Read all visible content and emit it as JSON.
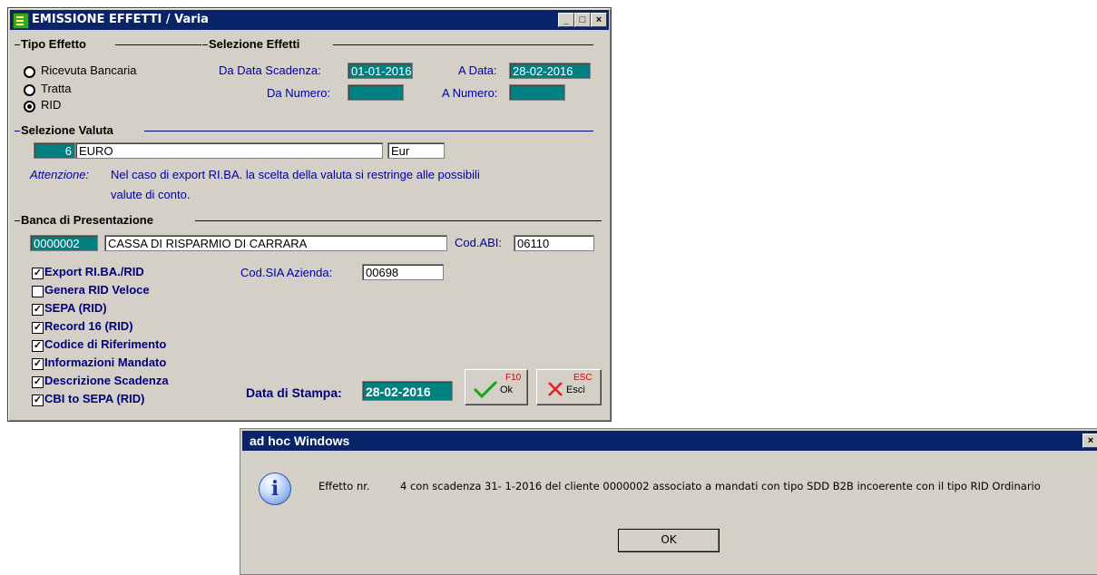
{
  "window": {
    "title": "EMISSIONE EFFETTI / Varia",
    "controls": {
      "minimize": "_",
      "maximize": "□",
      "close": "×"
    }
  },
  "tipo_effetto": {
    "heading": "Tipo Effetto",
    "options": [
      {
        "label": "Ricevuta Bancaria",
        "selected": false
      },
      {
        "label": "Tratta",
        "selected": false
      },
      {
        "label": "RID",
        "selected": true
      }
    ]
  },
  "selezione_effetti": {
    "heading": "Selezione Effetti",
    "da_data_label": "Da Data Scadenza:",
    "da_data_value": "01-01-2016",
    "a_data_label": "A Data:",
    "a_data_value": "28-02-2016",
    "da_numero_label": "Da Numero:",
    "da_numero_value": "",
    "a_numero_label": "A Numero:",
    "a_numero_value": ""
  },
  "selezione_valuta": {
    "heading": "Selezione Valuta",
    "code": "6",
    "name": "EURO",
    "symbol": "Eur",
    "note_label": "Attenzione:",
    "note_line1": "Nel caso di export RI.BA. la scelta della valuta si restringe alle possibili",
    "note_line2": "valute di conto."
  },
  "banca": {
    "heading": "Banca di Presentazione",
    "code": "0000002",
    "name": "CASSA DI RISPARMIO DI CARRARA",
    "abi_label": "Cod.ABI:",
    "abi_value": "06110",
    "sia_label": "Cod.SIA Azienda:",
    "sia_value": "00698"
  },
  "checkboxes": [
    {
      "label": "Export RI.BA./RID",
      "checked": true
    },
    {
      "label": "Genera RID Veloce",
      "checked": false
    },
    {
      "label": "SEPA (RID)",
      "checked": true
    },
    {
      "label": "Record 16 (RID)",
      "checked": true
    },
    {
      "label": "Codice di Riferimento",
      "checked": true
    },
    {
      "label": "Informazioni Mandato",
      "checked": true
    },
    {
      "label": "Descrizione Scadenza",
      "checked": true
    },
    {
      "label": "CBI to SEPA (RID)",
      "checked": true
    }
  ],
  "stampa": {
    "label": "Data di Stampa:",
    "value": "28-02-2016"
  },
  "buttons": {
    "ok": {
      "key": "F10",
      "label": "Ok"
    },
    "esci": {
      "key": "ESC",
      "label": "Esci"
    }
  },
  "dialog": {
    "title": "ad hoc Windows",
    "message_prefix": "Effetto nr.",
    "message": "4 con scadenza 31- 1-2016 del cliente 0000002 associato a mandati con tipo SDD B2B incoerente con il tipo RID Ordinario",
    "ok_label": "OK",
    "close": "×"
  },
  "colors": {
    "titlebar": "#0a246a",
    "teal_field": "#008080",
    "label_blue": "#0000a0",
    "window_bg": "#d4d0c8"
  }
}
